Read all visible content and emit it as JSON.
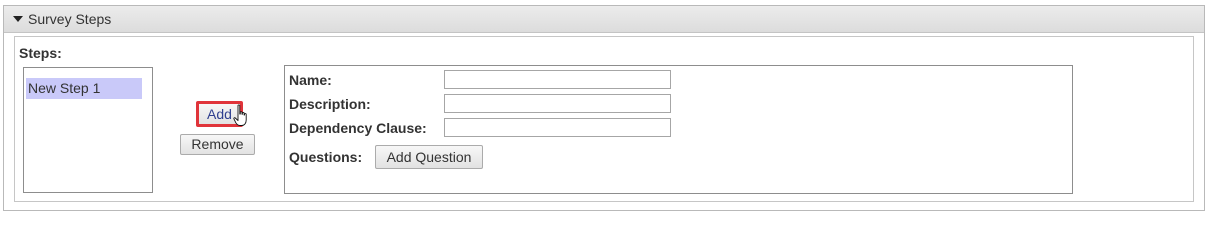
{
  "panel": {
    "title": "Survey Steps",
    "collapse_icon": "caret-down-icon"
  },
  "steps": {
    "label": "Steps:",
    "items": [
      "New Step 1"
    ],
    "selected_index": 0
  },
  "actions": {
    "add_label": "Add",
    "remove_label": "Remove",
    "add_highlight_color": "#e0343a",
    "cursor_icon": "hand-pointer-icon"
  },
  "details": {
    "name_label": "Name:",
    "name_value": "",
    "description_label": "Description:",
    "description_value": "",
    "dependency_label": "Dependency Clause:",
    "dependency_value": "",
    "questions_label": "Questions:",
    "add_question_label": "Add Question"
  },
  "colors": {
    "selection": "#c9c9f9",
    "header_background": "#dcdcdc"
  }
}
